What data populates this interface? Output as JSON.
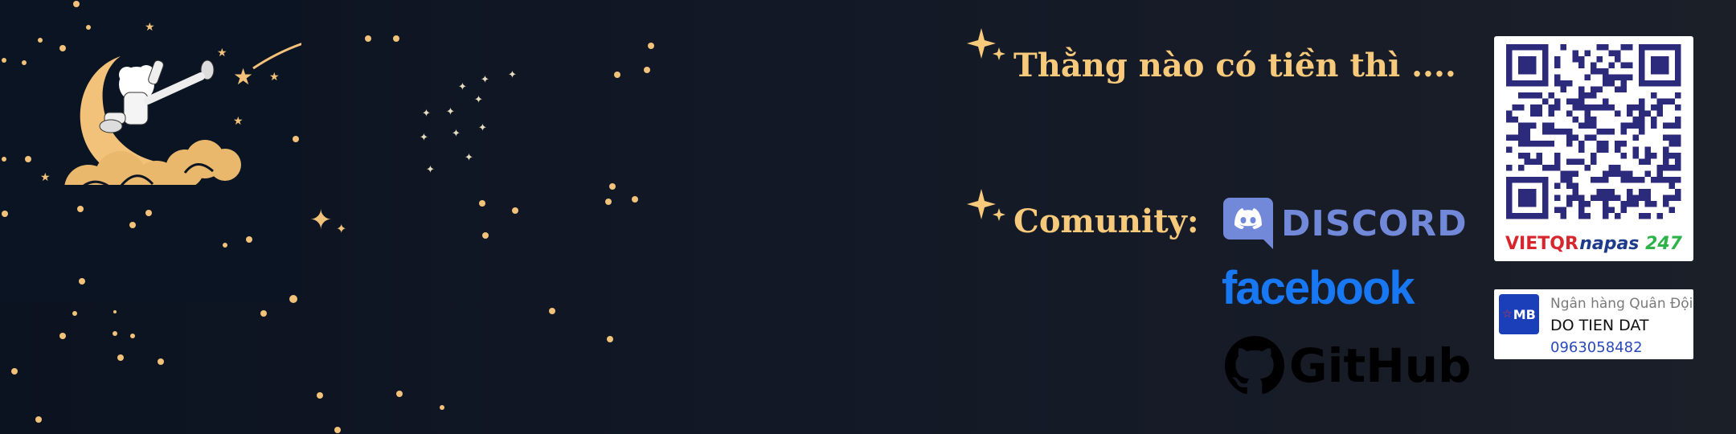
{
  "donate": {
    "heading": "Thằng nào có tiền thì ...."
  },
  "community": {
    "heading": "Comunity:",
    "links": [
      {
        "label": "DISCORD",
        "color": "#7289da"
      },
      {
        "label": "facebook",
        "color": "#1877f2"
      },
      {
        "label": "GitHub",
        "color": "#000000"
      }
    ]
  },
  "qr_card": {
    "left_brand": "VIETQR",
    "right_brand_main": "napas",
    "right_brand_num": "247"
  },
  "bank": {
    "logo_text": "MB",
    "bank_name": "Ngân hàng Quân Đội",
    "account_holder": "DO TIEN DAT",
    "account_number": "0963058482"
  },
  "colors": {
    "accent_gold": "#f6c97b",
    "background": "#121826"
  }
}
